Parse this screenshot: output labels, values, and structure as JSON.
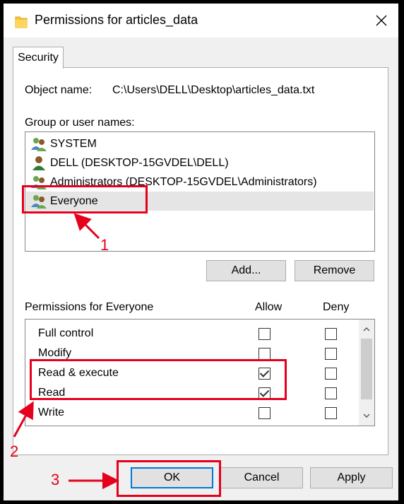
{
  "window": {
    "title": "Permissions for articles_data",
    "close_glyph": "✕"
  },
  "tab": {
    "label": "Security"
  },
  "object": {
    "label": "Object name:",
    "value": "C:\\Users\\DELL\\Desktop\\articles_data.txt"
  },
  "groups": {
    "label": "Group or user names:",
    "items": [
      {
        "name": "SYSTEM",
        "icon": "group-users-icon"
      },
      {
        "name": "DELL (DESKTOP-15GVDEL\\DELL)",
        "icon": "single-user-icon"
      },
      {
        "name": "Administrators (DESKTOP-15GVDEL\\Administrators)",
        "icon": "group-users-icon"
      },
      {
        "name": "Everyone",
        "icon": "group-users-icon",
        "selected": true
      }
    ],
    "add_label": "Add...",
    "remove_label": "Remove"
  },
  "permissions": {
    "title": "Permissions for Everyone",
    "allow_header": "Allow",
    "deny_header": "Deny",
    "rows": [
      {
        "name": "Full control",
        "allow": false,
        "deny": false
      },
      {
        "name": "Modify",
        "allow": false,
        "deny": false
      },
      {
        "name": "Read & execute",
        "allow": true,
        "deny": false
      },
      {
        "name": "Read",
        "allow": true,
        "deny": false
      },
      {
        "name": "Write",
        "allow": false,
        "deny": false
      }
    ]
  },
  "footer": {
    "ok_label": "OK",
    "cancel_label": "Cancel",
    "apply_label": "Apply"
  },
  "annotations": {
    "step1": "1",
    "step2": "2",
    "step3": "3",
    "color": "#e5001c"
  }
}
